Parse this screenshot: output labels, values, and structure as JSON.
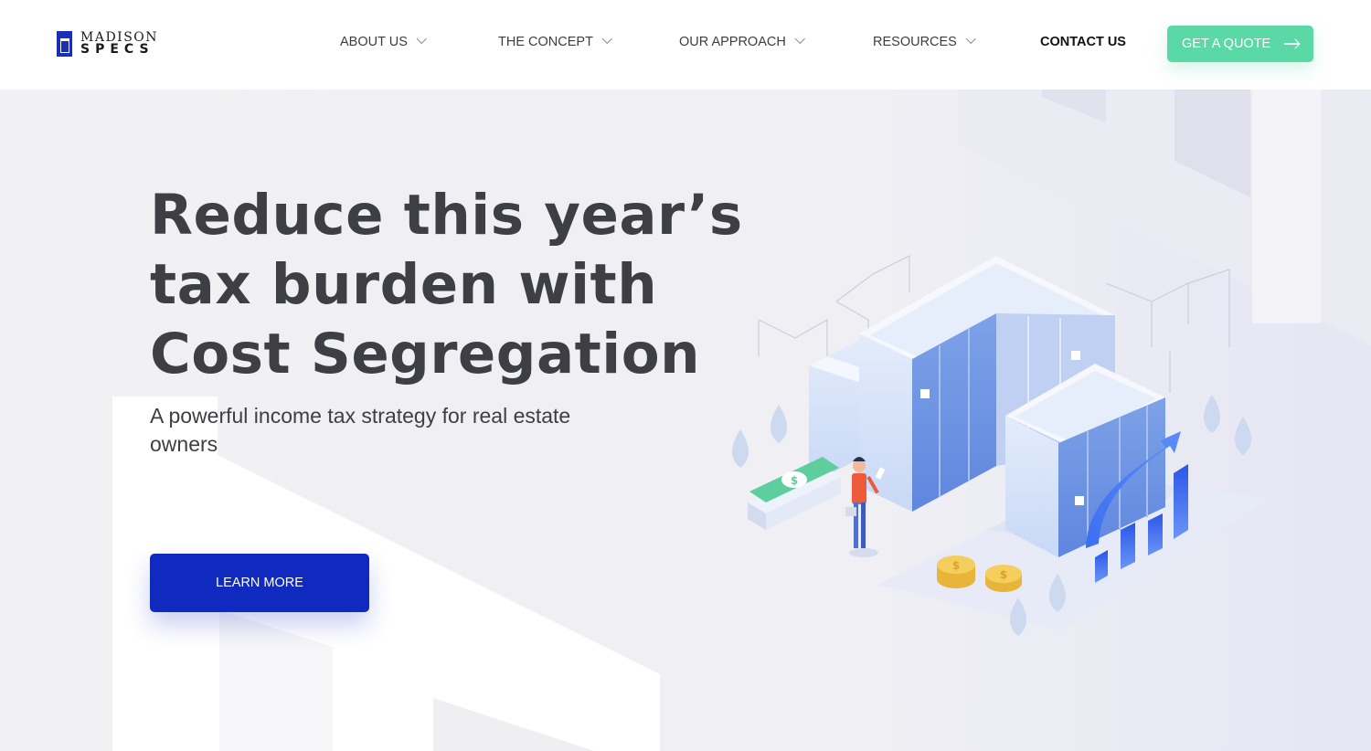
{
  "brand": {
    "line1": "MADISON",
    "line2": "SPECS",
    "mark_color": "#1a2fb5"
  },
  "nav": {
    "items": [
      {
        "label": "ABOUT US",
        "has_dropdown": true
      },
      {
        "label": "THE CONCEPT",
        "has_dropdown": true
      },
      {
        "label": "OUR APPROACH",
        "has_dropdown": true
      },
      {
        "label": "RESOURCES",
        "has_dropdown": true
      },
      {
        "label": "CONTACT US",
        "has_dropdown": false
      }
    ],
    "cta": {
      "label": "GET A QUOTE",
      "icon": "arrow-right-icon",
      "color": "#5ad8a6"
    }
  },
  "hero": {
    "title_lines": [
      "Reduce this year’s",
      "tax burden with",
      "Cost Segregation"
    ],
    "subtitle": "A powerful income tax strategy for real estate owners",
    "button": {
      "label": "LEARN MORE",
      "color": "#1029bf"
    }
  },
  "illustration": {
    "name": "isometric-buildings-illustration",
    "bill_symbol": "$",
    "coin_symbol": "$"
  },
  "colors": {
    "background": "#f1f1f3",
    "text": "#3e3f44",
    "accent_blue": "#1029bf",
    "accent_green": "#5ad8a6"
  }
}
